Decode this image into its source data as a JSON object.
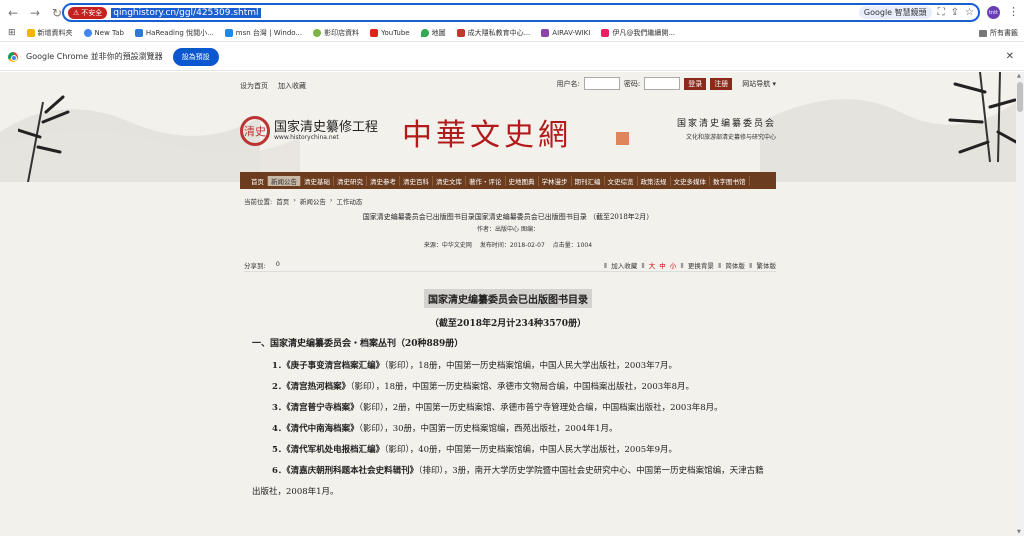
{
  "browser": {
    "security_label": "不安全",
    "url": "qinghistory.cn/ggl/425309.shtml",
    "translate_label": "Google 智慧鏡頭",
    "profile_initials": "tntt",
    "bookmarks": [
      {
        "label": "新增資料夾",
        "color": "#f2b600"
      },
      {
        "label": "New Tab",
        "color": "#4285f4"
      },
      {
        "label": "HaReading 悅閱小...",
        "color": "#2a7ad6"
      },
      {
        "label": "msn 台灣 | Windo...",
        "color": "#1e88e5"
      },
      {
        "label": "影印店資料",
        "color": "#7cb342"
      },
      {
        "label": "YouTube",
        "color": "#e62117"
      },
      {
        "label": "地圖",
        "color": "#34a853"
      },
      {
        "label": "成大隱私教育中心...",
        "color": "#c0392b"
      },
      {
        "label": "AIRAV-WIKI",
        "color": "#8e44ad"
      },
      {
        "label": "伊凡@我們繼續開...",
        "color": "#e91e63"
      }
    ],
    "all_bookmarks": "所有書籤",
    "infobar_text": "Google Chrome 並非你的預設瀏覽器",
    "infobar_button": "設為預設"
  },
  "site": {
    "top_links": [
      "设为首页",
      "加入收藏"
    ],
    "username_label": "用户名:",
    "password_label": "密码:",
    "login_button": "登录",
    "register_button": "注册",
    "site_nav": "网站导航 ▾",
    "seal_char": "清史",
    "project_name": "国家清史纂修工程",
    "project_url": "www.historychina.net",
    "site_title": "中華文史網",
    "committee_name": "国家清史编纂委员会",
    "committee_sub": "文化和旅游部清史纂修与研究中心",
    "nav_items": [
      "首页",
      "新闻公告",
      "清史基础",
      "清史研究",
      "清史参考",
      "清史百科",
      "清史文库",
      "著作・评论",
      "史地图典",
      "学林漫步",
      "期刊汇编",
      "文史综览",
      "政策法规",
      "文史多媒体",
      "数字图书馆"
    ],
    "nav_active_index": 1,
    "breadcrumb": [
      "当前位置:",
      "首页",
      "›",
      "新闻公告",
      "›",
      "工作动态"
    ]
  },
  "article": {
    "title": "国家清史编纂委员会已出版图书目录国家清史编纂委员会已出版图书目录 （截至2018年2月）",
    "author": "作者：出版中心 图编：",
    "source": "来源：中华文史网",
    "publish_time": "发布时间：2018-02-07",
    "clicks": "点击量：1004",
    "share_label": "分享到:",
    "share_count": "0",
    "tools": {
      "favorite": "加入收藏",
      "size_big": "大",
      "size_mid": "中",
      "size_small": "小",
      "bg": "更换背景",
      "simplified": "简体版",
      "traditional": "繁体版"
    },
    "doc_title": "国家清史编纂委员会已出版图书目录",
    "doc_subtitle": "（截至2018年2月计234种3570册）",
    "section_title": "一、国家清史编纂委员会・档案丛刊（20种889册）",
    "entries": [
      {
        "num": "1．",
        "book": "《庚子事变清宫档案汇编》",
        "rest": "（影印），18册，中国第一历史档案馆编，中国人民大学出版社，2003年7月。"
      },
      {
        "num": "2．",
        "book": "《清宫热河档案》",
        "rest": "（影印），18册，中国第一历史档案馆、承德市文物局合编，中国档案出版社，2003年8月。"
      },
      {
        "num": "3．",
        "book": "《清宫普宁寺档案》",
        "rest": "（影印），2册，中国第一历史档案馆、承德市普宁寺管理处合编，中国档案出版社，2003年8月。"
      },
      {
        "num": "4．",
        "book": "《清代中南海档案》",
        "rest": "（影印），30册，中国第一历史档案馆编，西苑出版社，2004年1月。"
      },
      {
        "num": "5．",
        "book": "《清代军机处电报档汇编》",
        "rest": "（影印），40册，中国第一历史档案馆编，中国人民大学出版社，2005年9月。"
      },
      {
        "num": "6．",
        "book": "《清嘉庆朝刑科题本社会史料辑刊》",
        "rest": "（排印），3册，南开大学历史学院暨中国社会史研究中心、中国第一历史档案馆编，天津古籍出版社，2008年1月。"
      }
    ]
  }
}
